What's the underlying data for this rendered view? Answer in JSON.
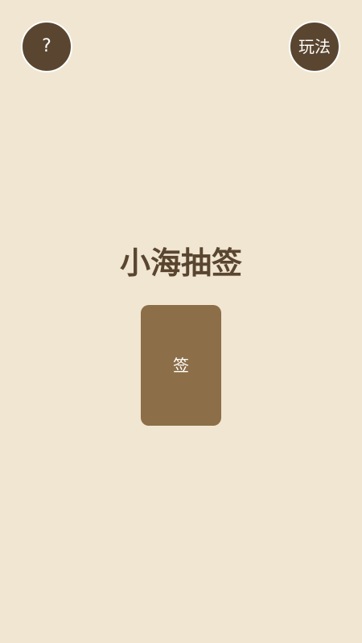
{
  "header": {
    "help_label": "?",
    "rules_label": "玩法"
  },
  "main": {
    "title": "小海抽签",
    "card_label": "签"
  },
  "colors": {
    "background": "#f0e6d2",
    "button": "#5a4630",
    "card": "#8c6e48",
    "title": "#5a4630"
  }
}
